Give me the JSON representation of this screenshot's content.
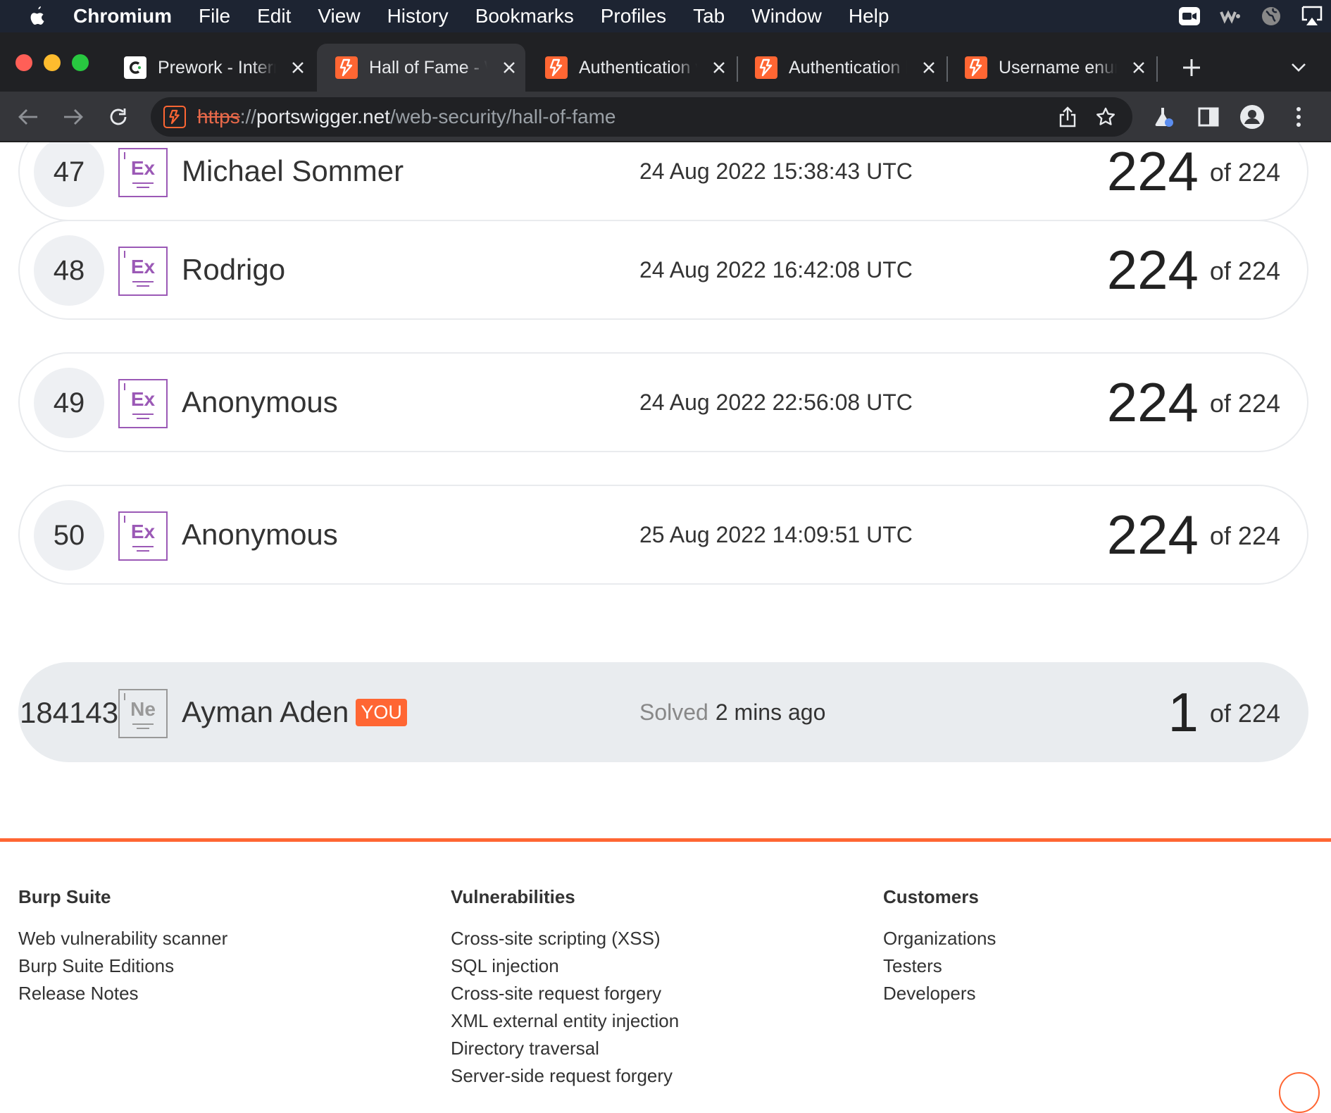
{
  "menubar": {
    "app": "Chromium",
    "items": [
      "File",
      "Edit",
      "View",
      "History",
      "Bookmarks",
      "Profiles",
      "Tab",
      "Window",
      "Help"
    ]
  },
  "tabs": [
    {
      "title": "Prework - Internship",
      "favicon": "codepath-icon",
      "active": false
    },
    {
      "title": "Hall of Fame - Web Security Academy",
      "favicon": "portswigger-icon",
      "active": true
    },
    {
      "title": "Authentication vulnerabilities",
      "favicon": "portswigger-icon",
      "active": false
    },
    {
      "title": "Authentication lab",
      "favicon": "portswigger-icon",
      "active": false
    },
    {
      "title": "Username enumeration",
      "favicon": "portswigger-icon",
      "active": false
    }
  ],
  "address_bar": {
    "scheme": "https",
    "separator": "://",
    "host": "portswigger.net",
    "path": "/web-security/hall-of-fame"
  },
  "leaderboard": [
    {
      "rank": "47",
      "badge": "Ex",
      "name": "Michael Sommer",
      "time": "24 Aug 2022 15:38:43 UTC",
      "solved": "224",
      "total": "of 224"
    },
    {
      "rank": "48",
      "badge": "Ex",
      "name": "Rodrigo",
      "time": "24 Aug 2022 16:42:08 UTC",
      "solved": "224",
      "total": "of 224"
    },
    {
      "rank": "49",
      "badge": "Ex",
      "name": "Anonymous",
      "time": "24 Aug 2022 22:56:08 UTC",
      "solved": "224",
      "total": "of 224"
    },
    {
      "rank": "50",
      "badge": "Ex",
      "name": "Anonymous",
      "time": "25 Aug 2022 14:09:51 UTC",
      "solved": "224",
      "total": "of 224"
    }
  ],
  "current_user": {
    "rank": "184143",
    "badge": "Ne",
    "name": "Ayman Aden",
    "tag": "YOU",
    "solved_label": "Solved",
    "solved_when": "2 mins ago",
    "solved": "1",
    "total": "of 224"
  },
  "footer": {
    "columns": [
      {
        "heading": "Burp Suite",
        "links": [
          "Web vulnerability scanner",
          "Burp Suite Editions",
          "Release Notes"
        ]
      },
      {
        "heading": "Vulnerabilities",
        "links": [
          "Cross-site scripting (XSS)",
          "SQL injection",
          "Cross-site request forgery",
          "XML external entity injection",
          "Directory traversal",
          "Server-side request forgery"
        ]
      },
      {
        "heading": "Customers",
        "links": [
          "Organizations",
          "Testers",
          "Developers"
        ]
      }
    ]
  },
  "colors": {
    "accent": "#ff6633",
    "expert_badge": "#9b59b6",
    "novice_badge": "#999999"
  }
}
